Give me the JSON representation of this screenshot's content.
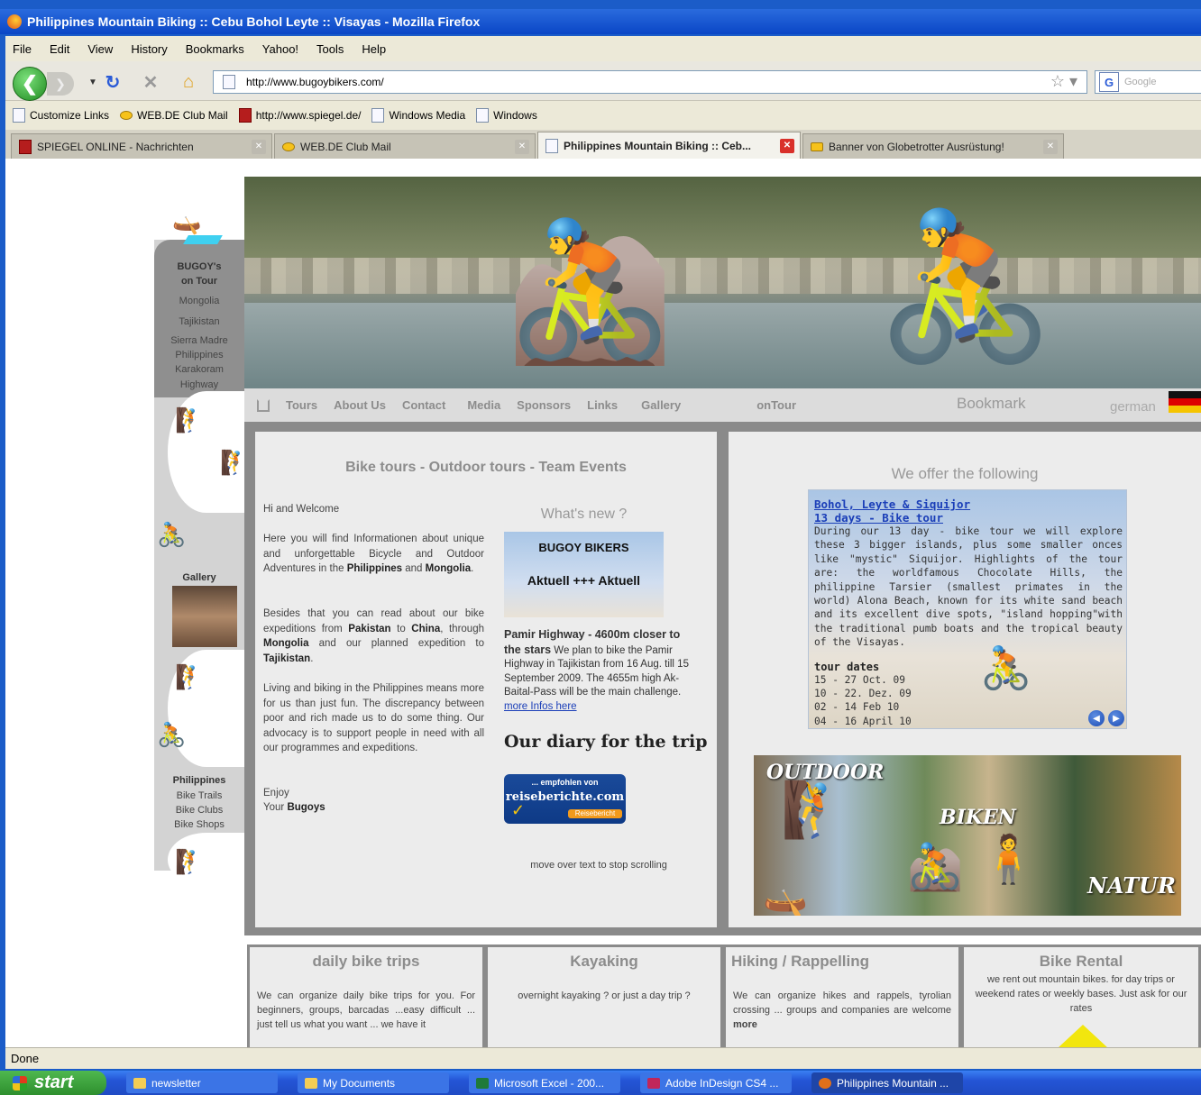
{
  "window": {
    "title": "Philippines Mountain Biking :: Cebu Bohol Leyte :: Visayas - Mozilla Firefox"
  },
  "menu": [
    "File",
    "Edit",
    "View",
    "History",
    "Bookmarks",
    "Yahoo!",
    "Tools",
    "Help"
  ],
  "nav": {
    "url": "http://www.bugoybikers.com/",
    "search_placeholder": "Google"
  },
  "bookmarks": [
    "Customize Links",
    "WEB.DE Club Mail",
    "http://www.spiegel.de/",
    "Windows Media",
    "Windows"
  ],
  "tabs": [
    {
      "label": "SPIEGEL ONLINE - Nachrichten"
    },
    {
      "label": "WEB.DE Club Mail"
    },
    {
      "label": "Philippines Mountain Biking :: Ceb..."
    },
    {
      "label": "Banner von Globetrotter Ausrüstung!"
    }
  ],
  "sidebar": {
    "tour_heading": [
      "BUGOY's",
      "on Tour"
    ],
    "tour_items": [
      "Mongolia",
      "Tajikistan",
      "Sierra Madre",
      "Philippines",
      "Karakoram",
      "Highway"
    ],
    "gallery": "Gallery",
    "ph_heading": "Philippines",
    "ph_items": [
      "Bike Trails",
      "Bike Clubs",
      "Bike Shops"
    ]
  },
  "site_menu": {
    "items": [
      "Tours",
      "About Us",
      "Contact",
      "Media",
      "Sponsors",
      "Links",
      "Gallery",
      "onTour"
    ],
    "bookmark": "Bookmark",
    "language": "german"
  },
  "left_panel": {
    "title": "Bike tours - Outdoor tours - Team Events",
    "greeting": "Hi and Welcome",
    "p1_plain1": "Here you will find Informationen about unique and unforgettable Bicycle and Outdoor Adventures in the ",
    "p1_bold1": "Philippines",
    "p1_plain2": " and ",
    "p1_bold2": "Mongolia",
    "p1_end": ".",
    "p2_plain1": "Besides that you can read about our bike expeditions from ",
    "p2_bold1": "Pakistan",
    "p2_plain2": " to ",
    "p2_bold2": "China",
    "p2_plain3": ", through ",
    "p2_bold3": "Mongolia",
    "p2_plain4": " and our planned expedition to ",
    "p2_bold4": "Tajikistan",
    "p2_end": ".",
    "p3": "Living and biking in the Philippines means more for us than just fun. The discrepancy between poor and rich made us to do some thing. Our advocacy is to support people in need with all our programmes and expeditions.",
    "enjoy": "Enjoy",
    "your": "Your ",
    "sign": "Bugoys",
    "whats_new": "What's new ?",
    "news_title": "BUGOY BIKERS",
    "news_sub": "Aktuell +++ Aktuell",
    "news_head": "Pamir Highway - 4600m closer to the stars",
    "news_body": " We plan to bike the Pamir Highway in Tajikistan from 16 Aug. till 15 September 2009. The 4655m high Ak-Baital-Pass will be the main challenge. ",
    "news_link": "more Infos here",
    "diary": "Our diary for the trip",
    "badge_small": "... empfohlen von",
    "badge_main": "reiseberichte.com",
    "badge_bar": "Reisebericht",
    "scroll_hint": "move over text to stop scrolling"
  },
  "right_panel": {
    "title": "We offer the following",
    "link1": "Bohol, Leyte & Siquijor",
    "link2": "13 days - Bike tour",
    "body": "During our 13 day - bike tour we will explore these 3 bigger islands, plus some smaller onces like \"mystic\" Siquijor. Highlights of the tour are: the worldfamous Chocolate Hills, the philippine Tarsier (smallest primates in the world) Alona Beach, known for its white sand beach and its excellent dive spots, \"island hopping\"with the traditional pumb boats and the tropical beauty of the Visayas.",
    "dates_title": "tour dates",
    "dates": [
      "15 - 27 Oct. 09",
      "10 - 22. Dez. 09",
      "02 - 14 Feb 10",
      "04 - 16 April 10"
    ],
    "collage_words": [
      "OUTDOOR",
      "BIKEN",
      "NATUR"
    ]
  },
  "bottom": [
    {
      "title": "daily bike trips",
      "text": "We can organize daily bike trips for you. For beginners, groups, barcadas ...easy difficult ... just tell us what you want ... we have it"
    },
    {
      "title": "Kayaking",
      "text": "overnight kayaking ? or just a day trip ?"
    },
    {
      "title": "Hiking / Rappelling",
      "text": "We can organize hikes and rappels, tyrolian crossing ... groups and companies are welcome ",
      "more": "more"
    },
    {
      "title": "Bike Rental",
      "text": "we rent out mountain bikes. for day trips or weekend rates or weekly bases. Just ask for our rates"
    }
  ],
  "status": "Done",
  "taskbar": {
    "start": "start",
    "items": [
      "newsletter",
      "My Documents",
      "Microsoft Excel - 200...",
      "Adobe InDesign CS4 ...",
      "Philippines Mountain ..."
    ]
  },
  "colors": {
    "titlebar": "#0a46c6",
    "panel_bg": "#ececec",
    "frame_grey": "#8a8a8a",
    "link_blue": "#1a3eb8"
  }
}
